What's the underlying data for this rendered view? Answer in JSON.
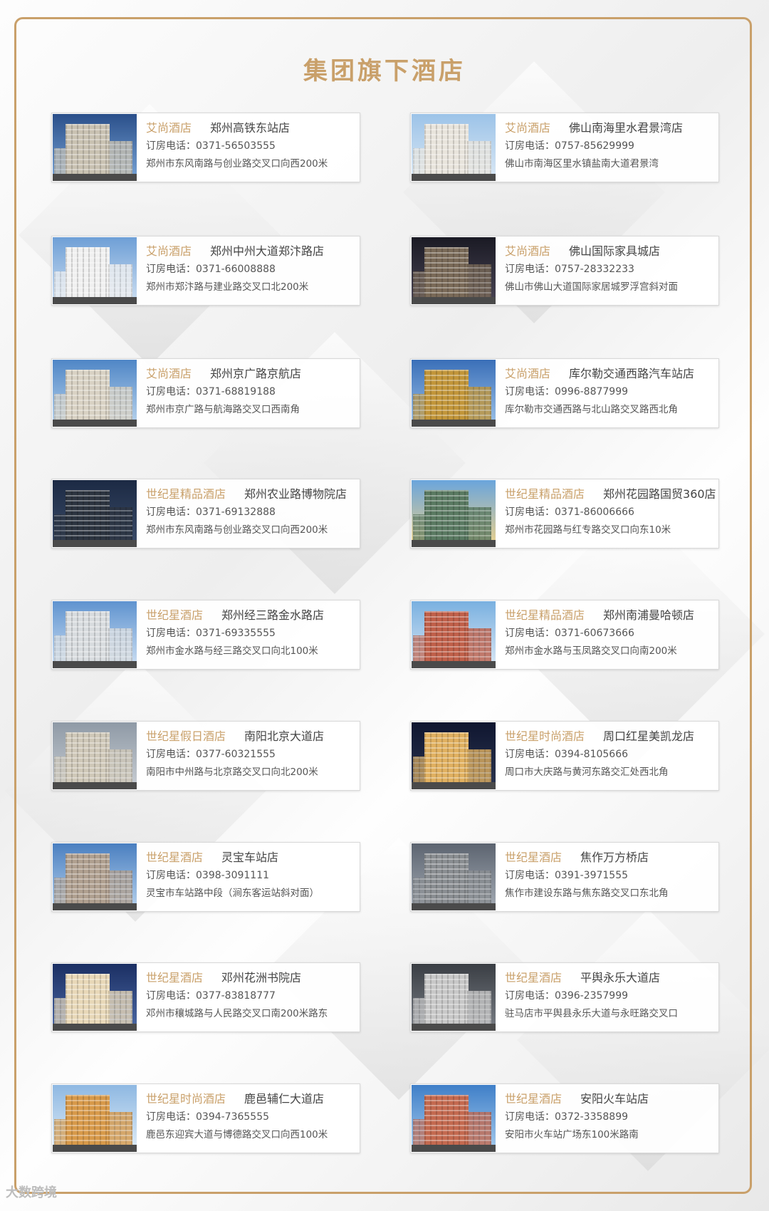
{
  "title": "集团旗下酒店",
  "phone_label": "订房电话：",
  "watermark": "大数跨境",
  "hotels": [
    {
      "brand": "艾尚酒店",
      "store": "郑州高铁东站店",
      "phone": "0371-56503555",
      "address": "郑州市东风南路与创业路交叉口向西200米"
    },
    {
      "brand": "艾尚酒店",
      "store": "佛山南海里水君景湾店",
      "phone": "0757-85629999",
      "address": "佛山市南海区里水镇盐南大道君景湾"
    },
    {
      "brand": "艾尚酒店",
      "store": "郑州中州大道郑汴路店",
      "phone": "0371-66008888",
      "address": "郑州市郑汴路与建业路交叉口北200米"
    },
    {
      "brand": "艾尚酒店",
      "store": "佛山国际家具城店",
      "phone": "0757-28332233",
      "address": "佛山市佛山大道国际家居城罗浮宫斜对面"
    },
    {
      "brand": "艾尚酒店",
      "store": "郑州京广路京航店",
      "phone": "0371-68819188",
      "address": "郑州市京广路与航海路交叉口西南角"
    },
    {
      "brand": "艾尚酒店",
      "store": "库尔勒交通西路汽车站店",
      "phone": "0996-8877999",
      "address": "库尔勒市交通西路与北山路交叉路西北角"
    },
    {
      "brand": "世纪星精品酒店",
      "store": "郑州农业路博物院店",
      "phone": "0371-69132888",
      "address": "郑州市东风南路与创业路交叉口向西200米"
    },
    {
      "brand": "世纪星精品酒店",
      "store": "郑州花园路国贸360店",
      "phone": "0371-86006666",
      "address": "郑州市花园路与红专路交叉口向东10米"
    },
    {
      "brand": "世纪星酒店",
      "store": "郑州经三路金水路店",
      "phone": "0371-69335555",
      "address": "郑州市金水路与经三路交叉口向北100米"
    },
    {
      "brand": "世纪星精品酒店",
      "store": "郑州南浦曼哈顿店",
      "phone": "0371-60673666",
      "address": "郑州市金水路与玉凤路交叉口向南200米"
    },
    {
      "brand": "世纪星假日酒店",
      "store": "南阳北京大道店",
      "phone": "0377-60321555",
      "address": "南阳市中州路与北京路交叉口向北200米"
    },
    {
      "brand": "世纪星时尚酒店",
      "store": "周口红星美凯龙店",
      "phone": "0394-8105666",
      "address": "周口市大庆路与黄河东路交汇处西北角"
    },
    {
      "brand": "世纪星酒店",
      "store": "灵宝车站店",
      "phone": "0398-3091111",
      "address": "灵宝市车站路中段（涧东客运站斜对面）"
    },
    {
      "brand": "世纪星酒店",
      "store": "焦作万方桥店",
      "phone": "0391-3971555",
      "address": "焦作市建设东路与焦东路交叉口东北角"
    },
    {
      "brand": "世纪星酒店",
      "store": "邓州花洲书院店",
      "phone": "0377-83818777",
      "address": "邓州市穰城路与人民路交叉口南200米路东"
    },
    {
      "brand": "世纪星酒店",
      "store": "平舆永乐大道店",
      "phone": "0396-2357999",
      "address": "驻马店市平舆县永乐大道与永旺路交叉口"
    },
    {
      "brand": "世纪星时尚酒店",
      "store": "鹿邑辅仁大道店",
      "phone": "0394-7365555",
      "address": "鹿邑东迎宾大道与博德路交叉口向西100米"
    },
    {
      "brand": "世纪星酒店",
      "store": "安阳火车站店",
      "phone": "0372-3358899",
      "address": "安阳市火车站广场东100米路南"
    }
  ]
}
